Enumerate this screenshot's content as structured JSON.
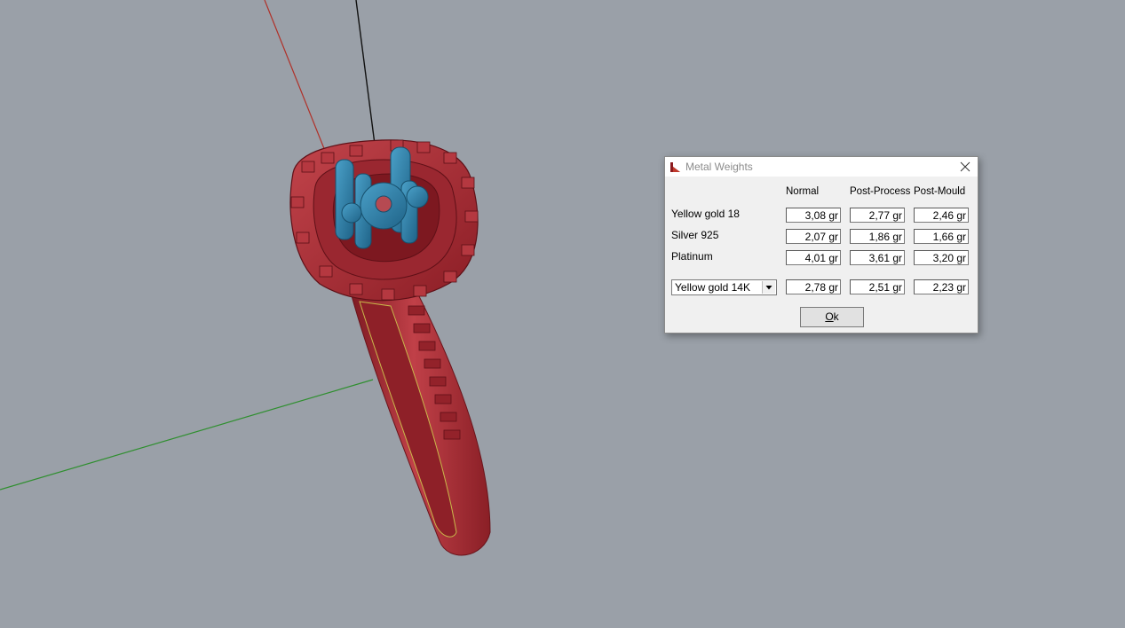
{
  "dialog": {
    "title": "Metal Weights",
    "columns": [
      "Normal",
      "Post-Process",
      "Post-Mould"
    ],
    "rows": [
      {
        "label": "Yellow gold 18",
        "values": [
          "3,08 gr",
          "2,77 gr",
          "2,46 gr"
        ]
      },
      {
        "label": "Silver 925",
        "values": [
          "2,07 gr",
          "1,86 gr",
          "1,66 gr"
        ]
      },
      {
        "label": "Platinum",
        "values": [
          "4,01 gr",
          "3,61 gr",
          "3,20 gr"
        ]
      }
    ],
    "custom": {
      "selected": "Yellow gold 14K",
      "values": [
        "2,78 gr",
        "2,51 gr",
        "2,23 gr"
      ]
    },
    "ok_label": "Ok",
    "ok_accelerator": "O",
    "ok_rest": "k"
  },
  "viewport": {
    "background": "#9aa0a8",
    "object": "ring-model",
    "colors": {
      "metal": "#a8252c",
      "stones": "#2f7fa6",
      "x_axis": "#b03028",
      "y_axis": "#2f8f2f",
      "z_axis": "#111111"
    }
  }
}
